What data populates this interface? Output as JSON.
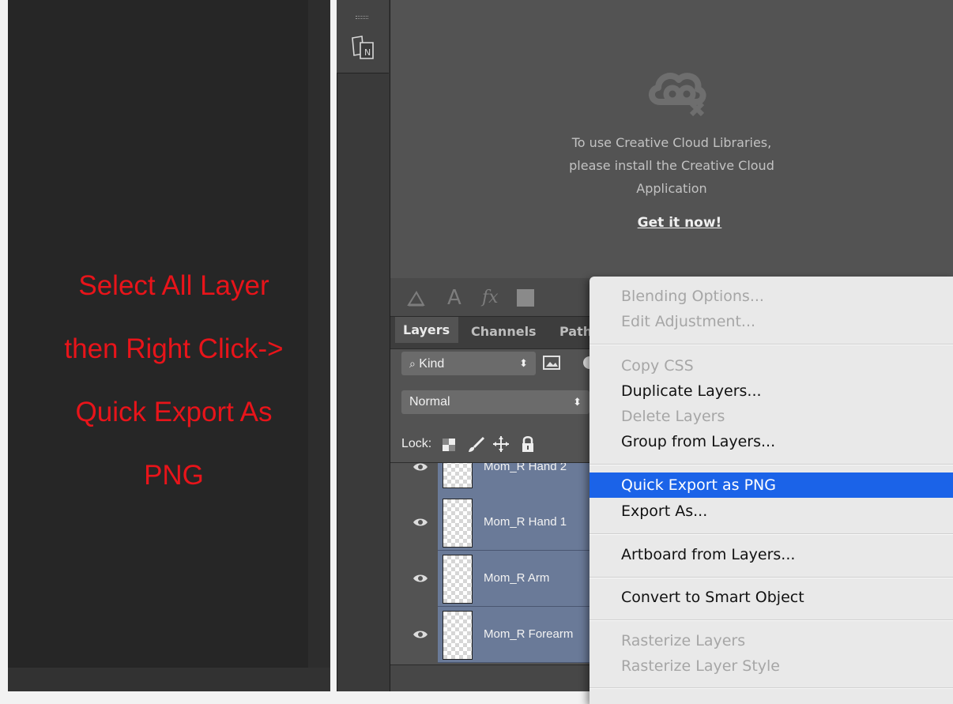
{
  "annotation": {
    "lines": [
      "Select All Layer",
      "then Right Click->",
      "Quick Export As",
      "PNG"
    ],
    "color": "#e8141a"
  },
  "libraries": {
    "message": "To use Creative Cloud Libraries,\nplease install the Creative Cloud\nApplication",
    "link": "Get it now!"
  },
  "layers_panel": {
    "tabs": [
      "Layers",
      "Channels",
      "Path"
    ],
    "filter_kind": "Kind",
    "blend_mode": "Normal",
    "lock_label": "Lock:",
    "layers": [
      {
        "name": "Mom_R Hand 2"
      },
      {
        "name": "Mom_R Hand 1"
      },
      {
        "name": "Mom_R Arm"
      },
      {
        "name": "Mom_R Forearm"
      }
    ],
    "selection_color": "#6a7a98"
  },
  "context_menu": {
    "items": [
      {
        "label": "Blending Options...",
        "enabled": false
      },
      {
        "label": "Edit Adjustment...",
        "enabled": false
      },
      {
        "label": "Copy CSS",
        "enabled": false
      },
      {
        "label": "Duplicate Layers...",
        "enabled": true
      },
      {
        "label": "Delete Layers",
        "enabled": false
      },
      {
        "label": "Group from Layers...",
        "enabled": true
      },
      {
        "label": "Quick Export as PNG",
        "enabled": true,
        "highlighted": true
      },
      {
        "label": "Export As...",
        "enabled": true
      },
      {
        "label": "Artboard from Layers...",
        "enabled": true
      },
      {
        "label": "Convert to Smart Object",
        "enabled": true
      },
      {
        "label": "Rasterize Layers",
        "enabled": false
      },
      {
        "label": "Rasterize Layer Style",
        "enabled": false
      }
    ],
    "highlight_color": "#1b63e8"
  },
  "icons": {
    "tool_strip": "artboard-tool-icon",
    "cloud": "creative-cloud-disconnected-icon",
    "properties": [
      "pen-angle-icon",
      "type-icon",
      "fx-icon",
      "color-swatch-icon"
    ],
    "lock": [
      "lock-transparent-icon",
      "lock-paint-icon",
      "lock-position-icon",
      "lock-all-icon"
    ],
    "layer_visibility": "eye-icon"
  }
}
